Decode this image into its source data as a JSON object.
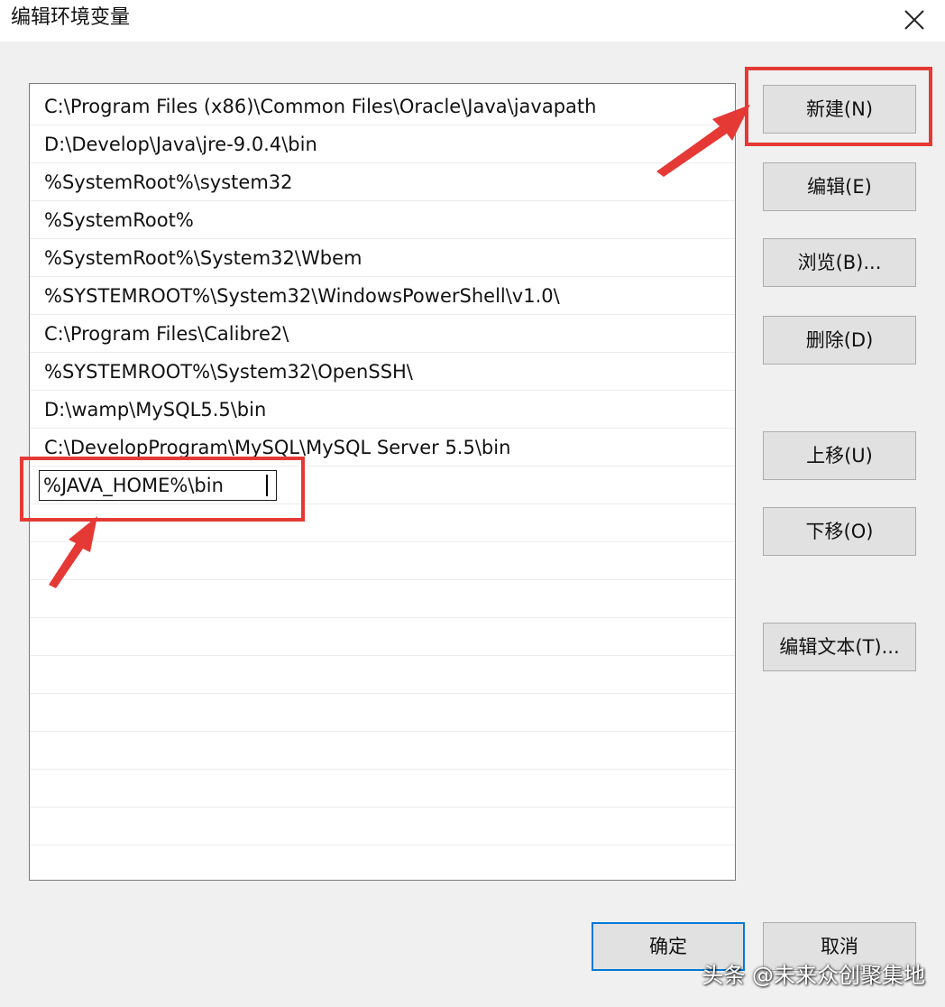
{
  "window": {
    "title": "编辑环境变量"
  },
  "path_entries": [
    "C:\\Program Files (x86)\\Common Files\\Oracle\\Java\\javapath",
    "D:\\Develop\\Java\\jre-9.0.4\\bin",
    "%SystemRoot%\\system32",
    "%SystemRoot%",
    "%SystemRoot%\\System32\\Wbem",
    "%SYSTEMROOT%\\System32\\WindowsPowerShell\\v1.0\\",
    "C:\\Program Files\\Calibre2\\",
    "%SYSTEMROOT%\\System32\\OpenSSH\\",
    "D:\\wamp\\MySQL5.5\\bin",
    "C:\\DevelopProgram\\MySQL\\MySQL Server 5.5\\bin"
  ],
  "editing_entry": {
    "value": "%JAVA_HOME%\\bin"
  },
  "buttons": {
    "new": "新建(N)",
    "edit": "编辑(E)",
    "browse": "浏览(B)...",
    "delete": "删除(D)",
    "move_up": "上移(U)",
    "move_down": "下移(O)",
    "edit_text": "编辑文本(T)...",
    "ok": "确定",
    "cancel": "取消"
  },
  "watermark": "头条 @未来众创聚集地",
  "colors": {
    "highlight": "#e53935",
    "default_button_border": "#0078d7"
  }
}
